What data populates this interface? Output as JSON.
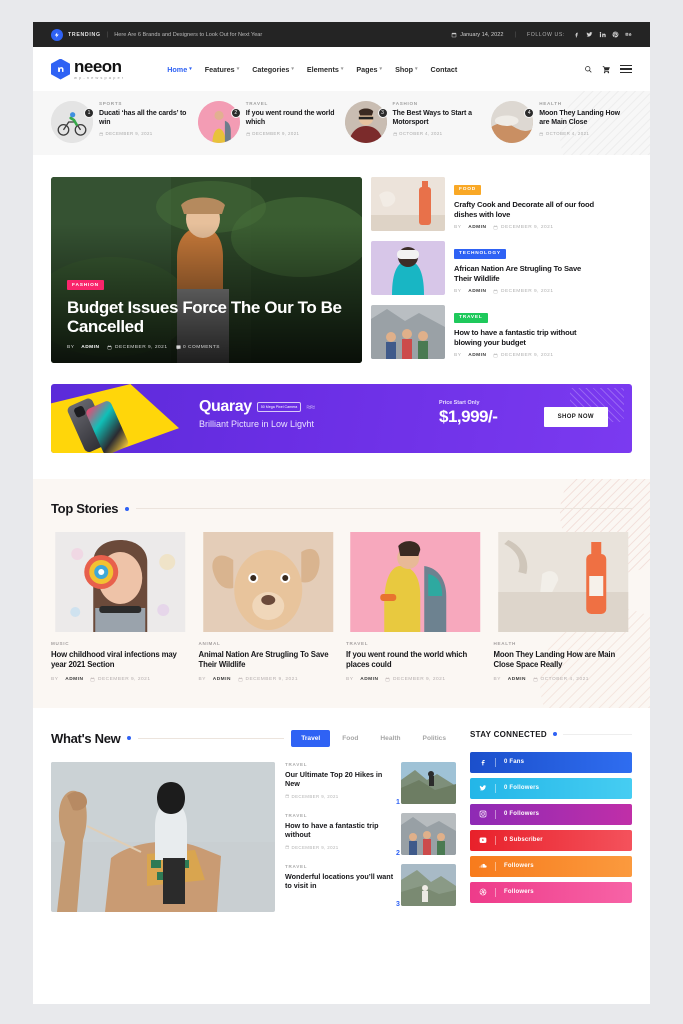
{
  "topbar": {
    "trending_label": "TRENDING",
    "trending_text": "Here Are 6 Brands and Designers to Look Out for Next Year",
    "date": "January 14, 2022",
    "follow_label": "FOLLOW US:",
    "separator": "|",
    "socials": [
      "facebook-icon",
      "twitter-icon",
      "linkedin-icon",
      "pinterest-icon",
      "behance-icon"
    ]
  },
  "header": {
    "logo_name": "neeon",
    "logo_sub": "wp-newspaper",
    "nav": [
      {
        "label": "Home",
        "caret": "▾",
        "active": true
      },
      {
        "label": "Features",
        "caret": "▾",
        "active": false
      },
      {
        "label": "Categories",
        "caret": "▾",
        "active": false
      },
      {
        "label": "Elements",
        "caret": "▾",
        "active": false
      },
      {
        "label": "Pages",
        "caret": "▾",
        "active": false
      },
      {
        "label": "Shop",
        "caret": "▾",
        "active": false
      },
      {
        "label": "Contact",
        "caret": "",
        "active": false
      }
    ],
    "tools": [
      "search-icon",
      "cart-icon",
      "menu-icon"
    ]
  },
  "trending_cards": [
    {
      "num": "1",
      "category": "SPORTS",
      "title": "Ducati ‘has all the cards’ to win",
      "date": "DECEMBER 9, 2021"
    },
    {
      "num": "2",
      "category": "TRAVEL",
      "title": "If you went round the world which",
      "date": "DECEMBER 9, 2021"
    },
    {
      "num": "3",
      "category": "FASHION",
      "title": "The Best Ways to Start a Motorsport",
      "date": "OCTOBER 4, 2021"
    },
    {
      "num": "4",
      "category": "HEALTH",
      "title": "Moon They Landing How are Main Close",
      "date": "OCTOBER 4, 2021"
    }
  ],
  "hero": {
    "badge": "FASHION",
    "title": "Budget Issues Force The Our To Be Cancelled",
    "by_label": "BY",
    "author": "ADMIN",
    "date": "DECEMBER 9, 2021",
    "comments": "0 COMMENTS"
  },
  "side_articles": [
    {
      "badge": "FOOD",
      "badge_class": "food",
      "title": "Crafty Cook and Decorate all of our food dishes with love",
      "by_label": "BY",
      "author": "ADMIN",
      "date": "DECEMBER 9, 2021"
    },
    {
      "badge": "TECHNOLOGY",
      "badge_class": "technology",
      "title": "African Nation Are Strugling To Save Their Wildlife",
      "by_label": "BY",
      "author": "ADMIN",
      "date": "DECEMBER 9, 2021"
    },
    {
      "badge": "TRAVEL",
      "badge_class": "travel",
      "title": "How to have a fantastic trip without blowing your budget",
      "by_label": "BY",
      "author": "ADMIN",
      "date": "DECEMBER 9, 2021"
    }
  ],
  "ad": {
    "brand": "Quaray",
    "chip": "50 Mega Pixel Camera",
    "tagline": "Brilliant Picture in Low Ligvht",
    "price_label": "Price Start Only",
    "price": "$1,999/-",
    "button": "SHOP NOW"
  },
  "top_stories": {
    "title": "Top Stories",
    "items": [
      {
        "category": "MUSIC",
        "title": "How childhood viral infections may year 2021 Section",
        "by_label": "BY",
        "author": "ADMIN",
        "date": "DECEMBER 9, 2021"
      },
      {
        "category": "ANIMAL",
        "title": "Animal Nation Are Strugling To Save Their Wildlife",
        "by_label": "BY",
        "author": "ADMIN",
        "date": "DECEMBER 9, 2021"
      },
      {
        "category": "TRAVEL",
        "title": "If you went round the world which places could",
        "by_label": "BY",
        "author": "ADMIN",
        "date": "DECEMBER 9, 2021"
      },
      {
        "category": "HEALTH",
        "title": "Moon They Landing How are Main Close Space Really",
        "by_label": "BY",
        "author": "ADMIN",
        "date": "OCTOBER 4, 2021"
      }
    ]
  },
  "whats_new": {
    "title": "What's New",
    "tabs": [
      {
        "label": "Travel",
        "active": true
      },
      {
        "label": "Food",
        "active": false
      },
      {
        "label": "Health",
        "active": false
      },
      {
        "label": "Politics",
        "active": false
      }
    ],
    "list": [
      {
        "num": "1",
        "category": "TRAVEL",
        "title": "Our Ultimate Top 20 Hikes in New",
        "date": "DECEMBER 9, 2021"
      },
      {
        "num": "2",
        "category": "TRAVEL",
        "title": "How to have a fantastic trip without",
        "date": "DECEMBER 9, 2021"
      },
      {
        "num": "3",
        "category": "TRAVEL",
        "title": "Wonderful locations you’ll want to visit in",
        "date": ""
      }
    ]
  },
  "stay_connected": {
    "title": "STAY CONNECTED",
    "socials": [
      {
        "icon": "facebook-icon",
        "text": "0  Fans",
        "color_start": "#1b4fcb",
        "color_end": "#2f6df0"
      },
      {
        "icon": "twitter-icon",
        "text": "0  Followers",
        "color_start": "#23b6e8",
        "color_end": "#46cdf2"
      },
      {
        "icon": "instagram-icon",
        "text": "0  Followers",
        "color_start": "#8e2ab5",
        "color_end": "#c02fa8"
      },
      {
        "icon": "youtube-icon",
        "text": "0  Subscriber",
        "color_start": "#e8202a",
        "color_end": "#f4525c"
      },
      {
        "icon": "soundcloud-icon",
        "text": "Followers",
        "color_start": "#f77b1c",
        "color_end": "#fb9a3e"
      },
      {
        "icon": "dribbble-icon",
        "text": "Followers",
        "color_start": "#ee3b8a",
        "color_end": "#f763a6"
      }
    ]
  }
}
